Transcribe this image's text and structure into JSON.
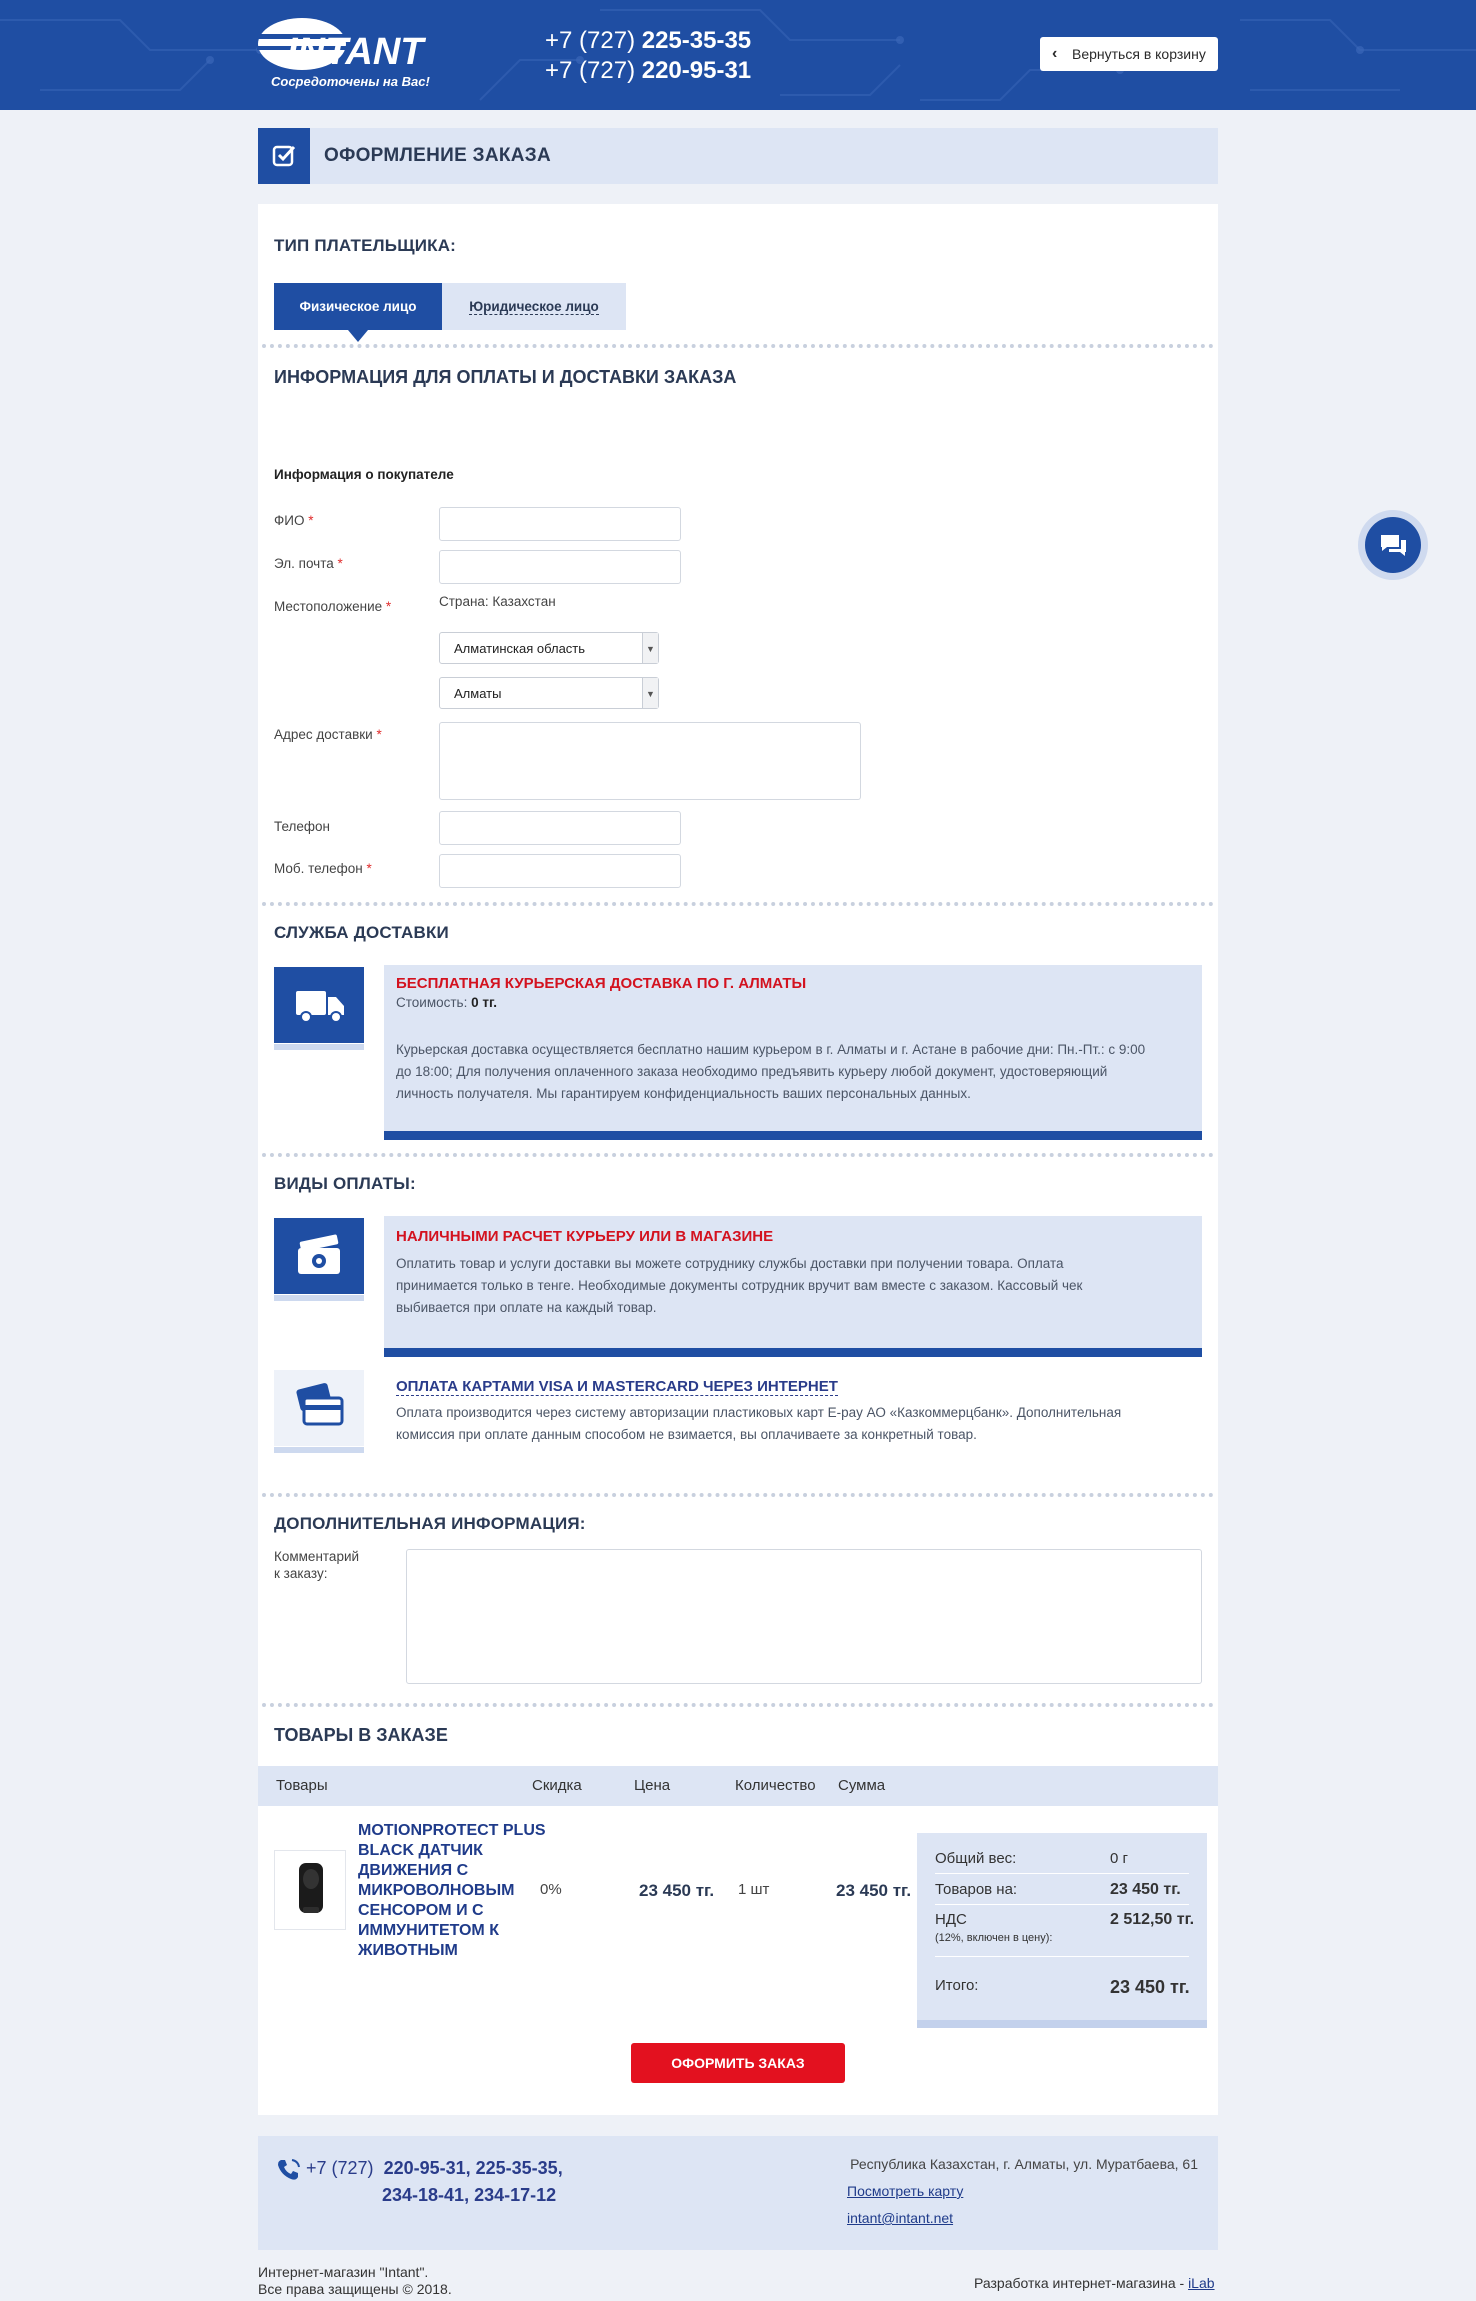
{
  "header": {
    "logo_text": "INTANT",
    "logo_slogan": "Сосредоточены на Вас!",
    "phone1_prefix": "+7 (727)",
    "phone1_number": "225-35-35",
    "phone2_prefix": "+7 (727)",
    "phone2_number": "220-95-31",
    "back_button": "Вернуться в корзину"
  },
  "page_title": "ОФОРМЛЕНИЕ ЗАКАЗА",
  "payer": {
    "heading": "ТИП ПЛАТЕЛЬЩИКА:",
    "tab_individual": "Физическое лицо",
    "tab_legal": "Юридическое лицо"
  },
  "billing_heading": "ИНФОРМАЦИЯ ДЛЯ ОПЛАТЫ И ДОСТАВКИ ЗАКАЗА",
  "buyer": {
    "heading": "Информация о покупателе",
    "fio_label": "ФИО",
    "email_label": "Эл. почта",
    "location_label": "Местоположение",
    "country_text": "Страна: Казахстан",
    "region_value": "Алматинская область",
    "city_value": "Алматы",
    "address_label": "Адрес доставки",
    "phone_label": "Телефон",
    "mobile_label": "Моб. телефон",
    "required_mark": "*"
  },
  "delivery": {
    "heading": "СЛУЖБА ДОСТАВКИ",
    "title": "БЕСПЛАТНАЯ КУРЬЕРСКАЯ ДОСТАВКА ПО Г. АЛМАТЫ",
    "cost_label": "Стоимость:",
    "cost_value": "0 тг.",
    "desc1": "Курьерская доставка осуществляется бесплатно нашим курьером в г. Алматы и г. Астане в рабочие дни: Пн.-Пт.: с 9:00",
    "desc2": "до 18:00; Для получения оплаченного заказа необходимо предъявить курьеру любой документ, удостоверяющий",
    "desc3": "личность получателя. Мы гарантируем конфиденциальность ваших персональных данных."
  },
  "payment": {
    "heading": "ВИДЫ ОПЛАТЫ:",
    "cash_title": "НАЛИЧНЫМИ РАСЧЕТ КУРЬЕРУ ИЛИ В МАГАЗИНЕ",
    "cash_desc1": "Оплатить товар и услуги доставки вы можете сотруднику службы доставки при получении товара. Оплата",
    "cash_desc2": "принимается только в тенге. Необходимые документы сотрудник вручит вам вместе с заказом. Кассовый чек",
    "cash_desc3": "выбивается при оплате на каждый товар.",
    "card_title": "ОПЛАТА КАРТАМИ VISA И MASTERCARD ЧЕРЕЗ ИНТЕРНЕТ",
    "card_desc1": "Оплата производится через систему авторизации пластиковых карт E-pay АО «Казкоммерцбанк». Дополнительная",
    "card_desc2": "комиссия при оплате данным способом не взимается, вы оплачиваете за конкретный товар."
  },
  "extra": {
    "heading": "ДОПОЛНИТЕЛЬНАЯ ИНФОРМАЦИЯ:",
    "comment_label1": "Комментарий",
    "comment_label2": "к заказу:"
  },
  "goods": {
    "heading": "ТОВАРЫ В ЗАКАЗЕ",
    "columns": {
      "items": "Товары",
      "discount": "Скидка",
      "price": "Цена",
      "qty": "Количество",
      "sum": "Сумма"
    },
    "row": {
      "name": "MOTIONPROTECT PLUS BLACK ДАТЧИК ДВИЖЕНИЯ С МИКРОВОЛНОВЫМ СЕНСОРОМ И С ИММУНИТЕТОМ К ЖИВОТНЫМ",
      "discount": "0%",
      "price": "23 450 тг.",
      "qty": "1 шт",
      "sum": "23 450 тг."
    }
  },
  "summary": {
    "weight_label": "Общий вес:",
    "weight_value": "0 г",
    "goods_label": "Товаров на:",
    "goods_value": "23 450 тг.",
    "vat_label": "НДС",
    "vat_note": "(12%, включен в цену):",
    "vat_value": "2 512,50 тг.",
    "total_label": "Итого:",
    "total_value": "23 450 тг."
  },
  "submit_button": "ОФОРМИТЬ ЗАКАЗ",
  "footer": {
    "phone_prefix": "+7 (727)",
    "phones_line1": "220-95-31, 225-35-35,",
    "phones_line2": "234-18-41, 234-17-12",
    "address": "Республика Казахстан, г. Алматы, ул. Муратбаева, 61",
    "map_link": "Посмотреть карту",
    "email": "intant@intant.net",
    "copyright1": "Интернет-магазин \"Intant\".",
    "copyright2": "Все права защищены © 2018.",
    "developer_text": "Разработка интернет-магазина -",
    "developer_link": "iLab"
  },
  "colors": {
    "primary": "#1f4ea3",
    "accent_red": "#e3111f",
    "panel": "#dde5f4"
  }
}
